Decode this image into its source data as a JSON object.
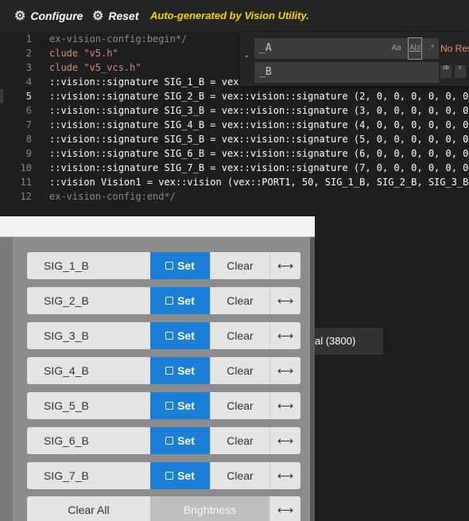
{
  "toolbar": {
    "configure_label": "Configure",
    "reset_label": "Reset",
    "note": "Auto-generated by Vision Utility."
  },
  "editor": {
    "line_numbers": [
      "1",
      "2",
      "3",
      "4",
      "5",
      "6",
      "7",
      "8",
      "9",
      "10",
      "11",
      "12"
    ],
    "lines": [
      "ex-vision-config:begin*/",
      "clude \"v5.h\"",
      "clude \"v5_vcs.h\"",
      "::vision::signature SIG_1_B = vex::",
      "::vision::signature SIG_2_B = vex::vision::signature (2, 0, 0, 0, 0, 0, 0",
      "::vision::signature SIG_3_B = vex::vision::signature (3, 0, 0, 0, 0, 0, 0",
      "::vision::signature SIG_4_B = vex::vision::signature (4, 0, 0, 0, 0, 0, 0",
      "::vision::signature SIG_5_B = vex::vision::signature (5, 0, 0, 0, 0, 0, 0",
      "::vision::signature SIG_6_B = vex::vision::signature (6, 0, 0, 0, 0, 0, 0",
      "::vision::signature SIG_7_B = vex::vision::signature (7, 0, 0, 0, 0, 0, 0",
      "::vision Vision1 = vex::vision (vex::PORT1, 50, SIG_1_B, SIG_2_B, SIG_3_B",
      "ex-vision-config:end*/"
    ]
  },
  "find_widget": {
    "find_value": "_A",
    "replace_value": "_B",
    "match_case_label": "Aa",
    "whole_word_label": "Abl",
    "regex_label": ".*",
    "no_results": "No Res",
    "replace_one_label": "cb",
    "replace_all_label": "c"
  },
  "status_tab": "al (3800)",
  "signatures": {
    "set_label": "Set",
    "clear_label": "Clear",
    "arrow_label": "⟷",
    "rows": [
      {
        "name": "SIG_1_B"
      },
      {
        "name": "SIG_2_B"
      },
      {
        "name": "SIG_3_B"
      },
      {
        "name": "SIG_4_B"
      },
      {
        "name": "SIG_5_B"
      },
      {
        "name": "SIG_6_B"
      },
      {
        "name": "SIG_7_B"
      }
    ]
  },
  "bottom": {
    "clear_all_label": "Clear All",
    "brightness_label": "Brightness",
    "arrow_label": "⟷"
  },
  "colors": {
    "accent": "#1a7fd6",
    "note": "#f2d400"
  }
}
